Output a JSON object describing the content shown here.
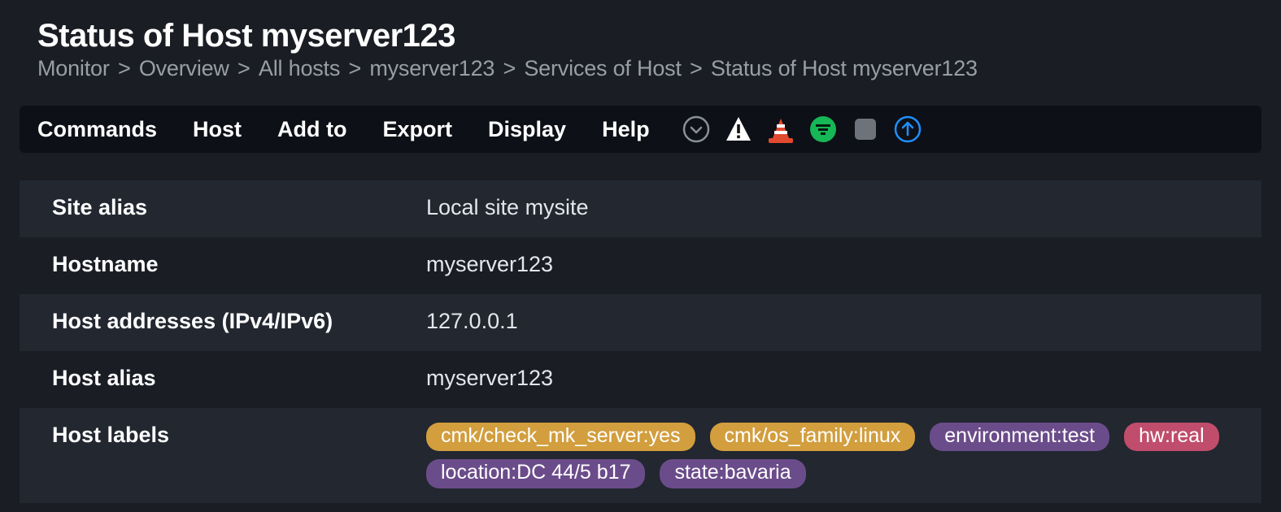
{
  "title": "Status of Host myserver123",
  "breadcrumb": {
    "items": [
      "Monitor",
      "Overview",
      "All hosts",
      "myserver123",
      "Services of Host",
      "Status of Host myserver123"
    ],
    "separator": ">"
  },
  "toolbar": {
    "menu": {
      "commands": "Commands",
      "host": "Host",
      "add_to": "Add to",
      "export": "Export",
      "display": "Display",
      "help": "Help"
    },
    "icon_names": {
      "chevron_down": "chevron-down-circle-icon",
      "warning": "warning-triangle-icon",
      "cone": "traffic-cone-icon",
      "filter": "filter-circle-icon",
      "stop": "stop-square-icon",
      "up_arrow": "arrow-up-circle-icon"
    }
  },
  "details": {
    "rows": {
      "site_alias": {
        "label": "Site alias",
        "value": "Local site mysite"
      },
      "hostname": {
        "label": "Hostname",
        "value": "myserver123"
      },
      "addresses": {
        "label": "Host addresses (IPv4/IPv6)",
        "value": "127.0.0.1"
      },
      "host_alias": {
        "label": "Host alias",
        "value": "myserver123"
      },
      "host_labels": {
        "label": "Host labels"
      }
    },
    "host_labels": [
      {
        "text": "cmk/check_mk_server:yes",
        "color": "gold"
      },
      {
        "text": "cmk/os_family:linux",
        "color": "gold"
      },
      {
        "text": "environment:test",
        "color": "purple"
      },
      {
        "text": "hw:real",
        "color": "red"
      },
      {
        "text": "location:DC 44/5 b17",
        "color": "purple"
      },
      {
        "text": "state:bavaria",
        "color": "purple"
      }
    ]
  }
}
